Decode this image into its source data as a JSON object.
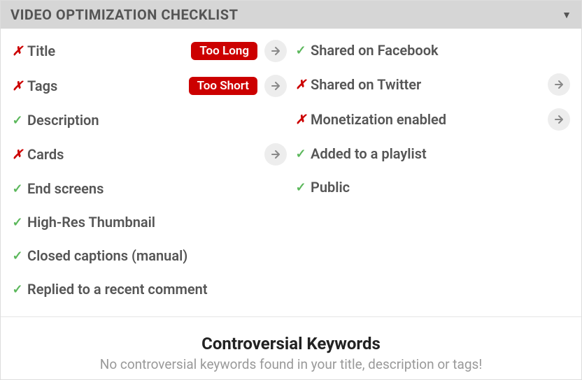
{
  "header": {
    "title": "VIDEO OPTIMIZATION CHECKLIST"
  },
  "checklist": {
    "left": [
      {
        "status": "bad",
        "label": "Title",
        "badge": "Too Long",
        "arrow": true
      },
      {
        "status": "bad",
        "label": "Tags",
        "badge": "Too Short",
        "arrow": true
      },
      {
        "status": "ok",
        "label": "Description"
      },
      {
        "status": "bad",
        "label": "Cards",
        "arrow": true
      },
      {
        "status": "ok",
        "label": "End screens"
      },
      {
        "status": "ok",
        "label": "High-Res Thumbnail"
      },
      {
        "status": "ok",
        "label": "Closed captions (manual)"
      },
      {
        "status": "ok",
        "label": "Replied to a recent comment"
      }
    ],
    "right": [
      {
        "status": "ok",
        "label": "Shared on Facebook"
      },
      {
        "status": "bad",
        "label": "Shared on Twitter",
        "arrow": true
      },
      {
        "status": "bad",
        "label": "Monetization enabled",
        "arrow": true
      },
      {
        "status": "ok",
        "label": "Added to a playlist"
      },
      {
        "status": "ok",
        "label": "Public"
      }
    ]
  },
  "keywords": {
    "title": "Controversial Keywords",
    "subtitle": "No controversial keywords found in your title, description or tags!"
  }
}
